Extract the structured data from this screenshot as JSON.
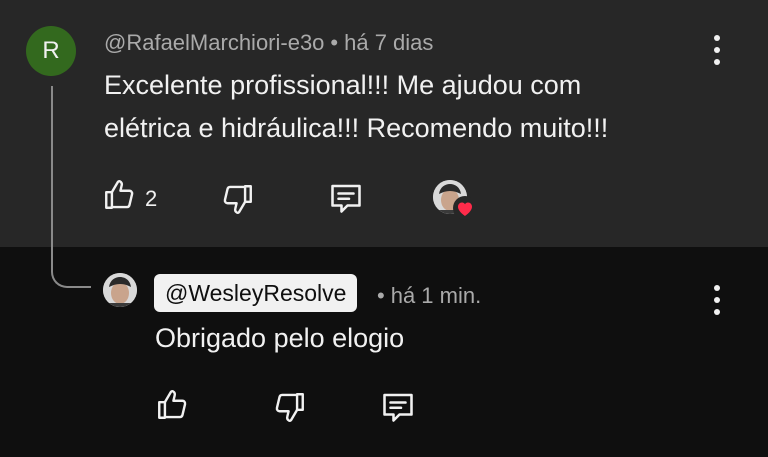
{
  "parent_comment": {
    "avatar_letter": "R",
    "author": "@RafaelMarchiori-e3o",
    "separator": "•",
    "time": "há 7 dias",
    "text_line1": "Excelente profissional!!! Me ajudou com",
    "text_line2": "elétrica e hidráulica!!! Recomendo muito!!!",
    "like_count": "2",
    "icons": [
      "like-icon",
      "dislike-icon",
      "reply-icon",
      "creator-heart-icon",
      "more-icon"
    ],
    "colors": {
      "background": "#272727",
      "avatar": "#33691e",
      "heart": "#ff2b4a"
    }
  },
  "reply": {
    "mention": "@WesleyResolve",
    "separator": "•",
    "time": "há 1 min.",
    "text": "Obrigado pelo elogio",
    "icons": [
      "like-icon",
      "dislike-icon",
      "reply-icon",
      "more-icon"
    ],
    "colors": {
      "background": "#0f0f0f",
      "mention_pill": "#f1f1f1"
    }
  }
}
